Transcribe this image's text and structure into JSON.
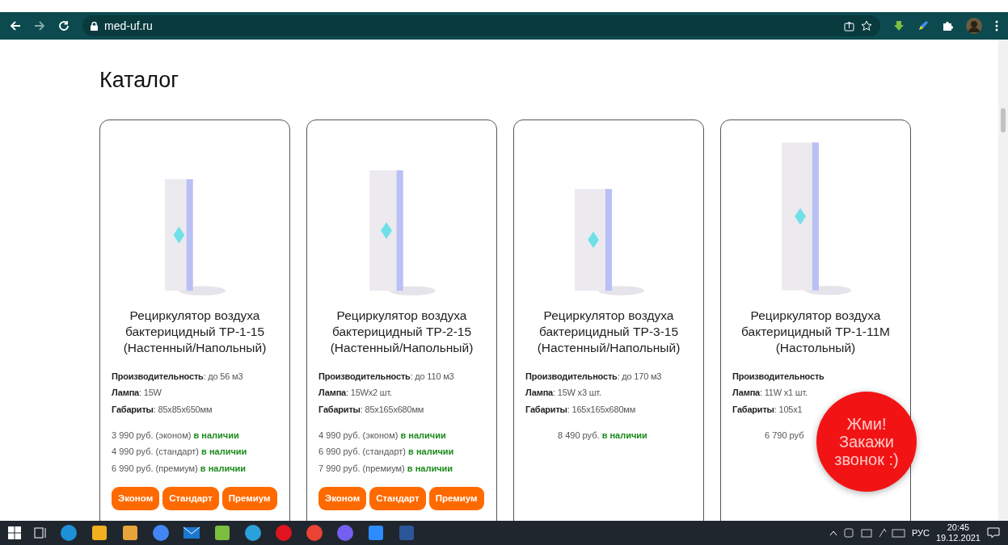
{
  "browser": {
    "url": "med-uf.ru"
  },
  "page": {
    "heading": "Каталог"
  },
  "products": [
    {
      "title": "Рециркулятор воздуха бактерицидный ТР-1-15 (Настенный/Напольный)",
      "specs": [
        {
          "label": "Производительность",
          "value": ": до 56 м3"
        },
        {
          "label": "Лампа",
          "value": ": 15W"
        },
        {
          "label": "Габариты",
          "value": ": 85х85х650мм"
        }
      ],
      "prices": [
        {
          "text": "3 990 руб. (эконом)",
          "status": "в наличии"
        },
        {
          "text": "4 990 руб. (стандарт)",
          "status": "в наличии"
        },
        {
          "text": "6 990 руб. (премиум)",
          "status": "в наличии"
        }
      ],
      "buttons": [
        "Эконом",
        "Стандарт",
        "Премиум"
      ]
    },
    {
      "title": "Рециркулятор воздуха бактерицидный ТР-2-15 (Настенный/Напольный)",
      "specs": [
        {
          "label": "Производительность",
          "value": ": до 110 м3"
        },
        {
          "label": "Лампа",
          "value": ": 15Wх2 шт."
        },
        {
          "label": "Габариты",
          "value": ": 85х165х680мм"
        }
      ],
      "prices": [
        {
          "text": "4 990 руб. (эконом)",
          "status": "в наличии"
        },
        {
          "text": "6 990 руб. (стандарт)",
          "status": "в наличии"
        },
        {
          "text": "7 990 руб. (премиум)",
          "status": "в наличии"
        }
      ],
      "buttons": [
        "Эконом",
        "Стандарт",
        "Премиум"
      ]
    },
    {
      "title": "Рециркулятор воздуха бактерицидный ТР-3-15 (Настенный/Напольный)",
      "specs": [
        {
          "label": "Производительность",
          "value": ": до 170 м3"
        },
        {
          "label": "Лампа",
          "value": ": 15W х3 шт."
        },
        {
          "label": "Габариты",
          "value": ": 165х165х680мм"
        }
      ],
      "prices": [
        {
          "text": "8 490 руб.",
          "status": "в наличии"
        }
      ]
    },
    {
      "title": "Рециркулятор воздуха бактерицидный ТР-1-11М (Настольный)",
      "specs": [
        {
          "label": "Производительность"
        },
        {
          "label": "Лампа",
          "value": ": 11W х1 шт."
        },
        {
          "label": "Габариты",
          "value": ": 105х1"
        }
      ],
      "prices": [
        {
          "text": "6 790 руб"
        }
      ]
    }
  ],
  "callback": {
    "text": "Жми! Закажи звонок :)"
  },
  "taskbar": {
    "language": "РУС",
    "time": "20:45",
    "date": "19.12.2021"
  }
}
